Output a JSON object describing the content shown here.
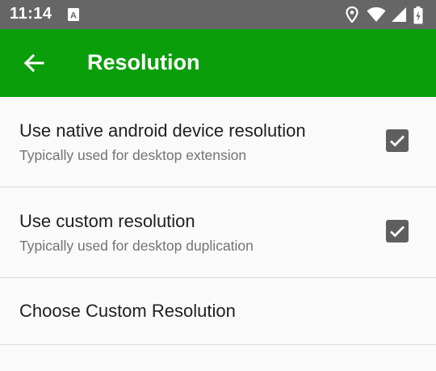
{
  "status_bar": {
    "time": "11:14",
    "icons": [
      "keyboard-a-icon",
      "location-icon",
      "wifi-icon",
      "signal-icon",
      "battery-icon"
    ]
  },
  "app_bar": {
    "title": "Resolution",
    "color": "#0a9e0a",
    "back_icon": "arrow-back-icon"
  },
  "settings": [
    {
      "title": "Use native android device resolution",
      "subtitle": "Typically used for desktop extension",
      "checked": true
    },
    {
      "title": "Use custom resolution",
      "subtitle": "Typically used for desktop duplication",
      "checked": true
    },
    {
      "title": "Choose Custom Resolution"
    }
  ]
}
